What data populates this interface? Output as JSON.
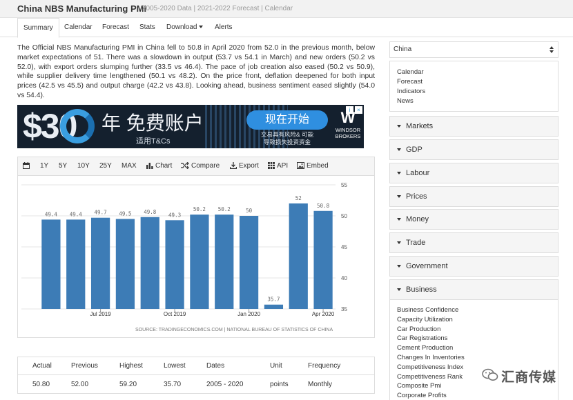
{
  "header": {
    "title": "China NBS Manufacturing PMI",
    "subtitle": "2005-2020 Data | 2021-2022 Forecast | Calendar"
  },
  "tabs": [
    {
      "label": "Summary",
      "active": true
    },
    {
      "label": "Calendar"
    },
    {
      "label": "Forecast"
    },
    {
      "label": "Stats"
    },
    {
      "label": "Download"
    },
    {
      "label": "Alerts"
    }
  ],
  "summary": "The Official NBS Manufacturing PMI in China fell to 50.8 in April 2020 from 52.0 in the previous month, below market expectations of 51. There was a slowdown in output (53.7 vs 54.1 in March) and new orders (50.2 vs 52.0), with export orders slumping further (33.5 vs 46.4). The pace of job creation also eased (50.2 vs 50.9), while supplier delivery time lengthened (50.1 vs 48.2). On the price front, deflation deepened for both input prices (42.5 vs 45.5) and output charge (42.2 vs 43.8). Looking ahead, business sentiment eased slightly (54.0 vs 54.4).",
  "ad": {
    "big": "$30",
    "line1": "年 免费账户",
    "line2": "适用T&Cs",
    "button": "现在开始",
    "risk": "交易具有风险& 可能\n导致损失投资资金",
    "logo_mark": "W",
    "logo_text": "WINDSOR\nBROKERS",
    "colors": {
      "bg": "#14202e",
      "button": "#2f8fe0"
    }
  },
  "toolbar": {
    "items": [
      "1Y",
      "5Y",
      "10Y",
      "25Y",
      "MAX"
    ],
    "chart": "Chart",
    "compare": "Compare",
    "export": "Export",
    "api": "API",
    "embed": "Embed"
  },
  "chart_data": {
    "type": "bar",
    "categories": [
      "2019-05",
      "2019-06",
      "2019-07",
      "2019-08",
      "2019-09",
      "2019-10",
      "2019-11",
      "2019-12",
      "2020-01",
      "2020-02",
      "2020-03",
      "2020-04"
    ],
    "values": [
      49.4,
      49.4,
      49.7,
      49.5,
      49.8,
      49.3,
      50.2,
      50.2,
      50,
      35.7,
      52,
      50.8
    ],
    "value_labels": [
      "49.4",
      "49.4",
      "49.7",
      "49.5",
      "49.8",
      "49.3",
      "50.2",
      "50.2",
      "50",
      "35.7",
      "52",
      "50.8"
    ],
    "x_ticks": [
      {
        "index": 2,
        "label": "Jul 2019"
      },
      {
        "index": 5,
        "label": "Oct 2019"
      },
      {
        "index": 8,
        "label": "Jan 2020"
      },
      {
        "index": 11,
        "label": "Apr 2020"
      }
    ],
    "y_ticks": [
      35,
      40,
      45,
      50,
      55
    ],
    "ylim": [
      35,
      55
    ],
    "grid": true,
    "bar_color": "#3d7cb6",
    "source": "SOURCE: TRADINGECONOMICS.COM | NATIONAL BUREAU OF STATISTICS OF CHINA"
  },
  "stats": {
    "headers": [
      "Actual",
      "Previous",
      "Highest",
      "Lowest",
      "Dates",
      "Unit",
      "Frequency"
    ],
    "values": [
      "50.80",
      "52.00",
      "59.20",
      "35.70",
      "2005 - 2020",
      "points",
      "Monthly"
    ]
  },
  "sidebar": {
    "select": "China",
    "links": [
      "Calendar",
      "Forecast",
      "Indicators",
      "News"
    ],
    "accordion": [
      "Markets",
      "GDP",
      "Labour",
      "Prices",
      "Money",
      "Trade",
      "Government",
      "Business"
    ],
    "business_items": [
      "Business Confidence",
      "Capacity Utilization",
      "Car Production",
      "Car Registrations",
      "Cement Production",
      "Changes In Inventories",
      "Competitiveness Index",
      "Competitiveness Rank",
      "Composite Pmi",
      "Corporate Profits"
    ]
  },
  "watermark": "汇商传媒"
}
